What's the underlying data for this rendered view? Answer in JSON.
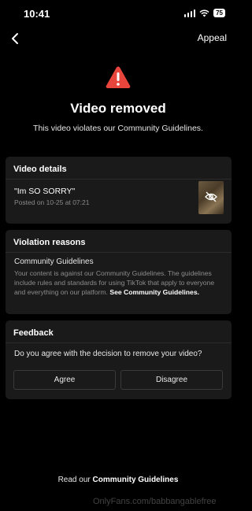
{
  "status_bar": {
    "time": "10:41",
    "battery": "75"
  },
  "nav": {
    "appeal_label": "Appeal"
  },
  "header": {
    "title": "Video removed",
    "subtitle": "This video violates our Community Guidelines."
  },
  "video_details": {
    "heading": "Video details",
    "video_title": "\"Im SO SORRY\"",
    "posted": "Posted on 10-25 at 07:21"
  },
  "violation": {
    "heading": "Violation reasons",
    "reason": "Community Guidelines",
    "description": "Your content is against our Community Guidelines. The guidelines include rules and standards for using TikTok that apply to everyone and everything on our platform.",
    "see_link": "See Community Guidelines."
  },
  "feedback": {
    "heading": "Feedback",
    "question": "Do you agree with the decision to remove your video?",
    "agree_label": "Agree",
    "disagree_label": "Disagree"
  },
  "footer": {
    "prefix": "Read our",
    "link": "Community Guidelines"
  },
  "watermark": "OnlyFans.com/babbangablefree",
  "colors": {
    "warning": "#e8453c",
    "background": "#000000",
    "card": "#1a1a1a"
  }
}
